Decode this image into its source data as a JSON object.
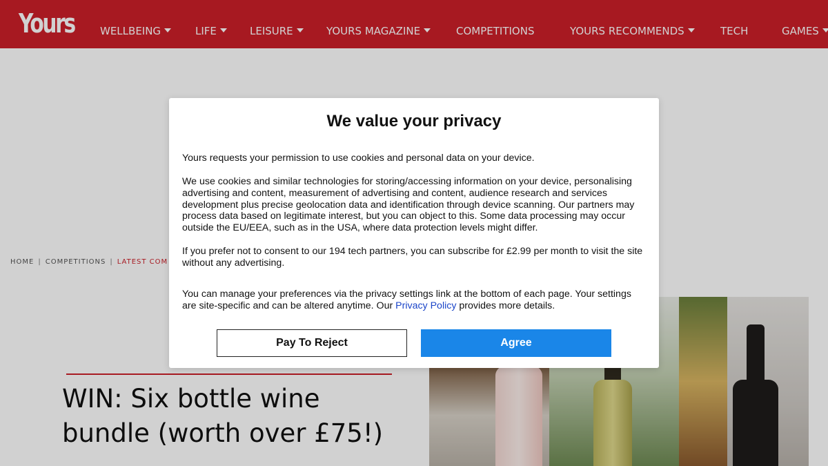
{
  "header": {
    "logo": "Yours",
    "brand_color": "#cc1f29",
    "nav": [
      {
        "label": "WELLBEING",
        "dropdown": true
      },
      {
        "label": "LIFE",
        "dropdown": true
      },
      {
        "label": "LEISURE",
        "dropdown": true
      },
      {
        "label": "YOURS MAGAZINE",
        "dropdown": true
      },
      {
        "label": "COMPETITIONS",
        "dropdown": false
      },
      {
        "label": "YOURS RECOMMENDS",
        "dropdown": true
      },
      {
        "label": "TECH",
        "dropdown": false
      },
      {
        "label": "GAMES",
        "dropdown": true
      }
    ]
  },
  "breadcrumb": {
    "items": [
      "HOME",
      "COMPETITIONS",
      "LATEST COM"
    ],
    "separator": "|"
  },
  "article": {
    "title": "WIN: Six bottle wine bundle (worth over £75!)"
  },
  "consent": {
    "title": "We value your privacy",
    "para1": "Yours requests your permission to use cookies and personal data on your device.",
    "para2": "We use cookies and similar technologies for storing/accessing information on your device, personalising advertising and content, measurement of advertising and content, audience research and services development plus precise geolocation data and identification through device scanning. Our partners may process data based on legitimate interest, but you can object to this. Some data processing may occur outside the EU/EEA, such as in the USA, where data protection levels might differ.",
    "para3": "If you prefer not to consent to our 194 tech partners, you can subscribe for £2.99 per month to visit the site without any advertising.",
    "para4_before": "You can manage your preferences via the privacy settings link at the bottom of each page. Your settings are site-specific and can be altered anytime. Our ",
    "para4_link": "Privacy Policy",
    "para4_after": " provides more details.",
    "reject_label": "Pay To Reject",
    "agree_label": "Agree",
    "agree_color": "#1a86e8"
  }
}
